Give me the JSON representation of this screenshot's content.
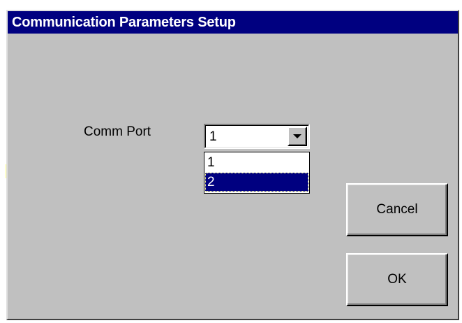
{
  "dialog": {
    "title": "Communication Parameters Setup"
  },
  "comm_port": {
    "label": "Comm Port",
    "selected_value": "1",
    "options": [
      "1",
      "2"
    ],
    "highlighted_option": "2"
  },
  "buttons": {
    "cancel_label": "Cancel",
    "ok_label": "OK"
  },
  "colors": {
    "titlebar": "#000080",
    "dialog_face": "#c0c0c0",
    "highlight": "#000080"
  },
  "icons": {
    "combo_button": "chevron-down-icon"
  }
}
